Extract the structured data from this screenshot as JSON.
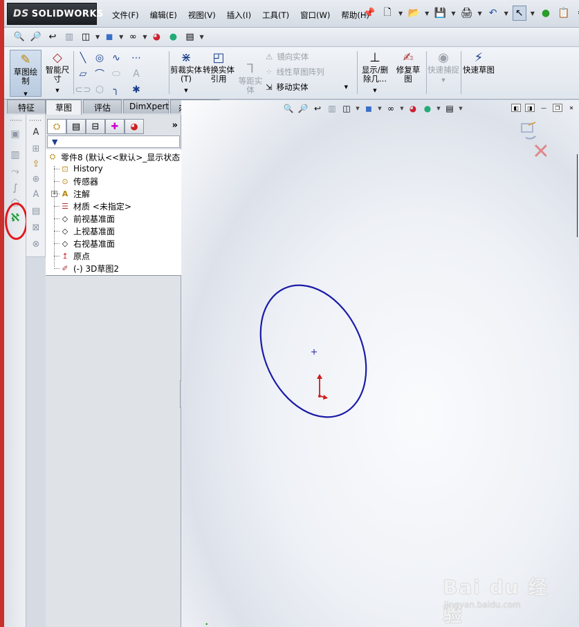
{
  "app": {
    "logo_ds": "DS",
    "logo_text": "SOLIDWORKS"
  },
  "menu": {
    "items": [
      "文件(F)",
      "编辑(E)",
      "视图(V)",
      "插入(I)",
      "工具(T)",
      "窗口(W)",
      "帮助(H)"
    ]
  },
  "command_manager": {
    "sketch": "草图绘制",
    "smart_dim": "智能尺寸",
    "trim": "剪裁实体(T)",
    "convert": "转换实体引用",
    "offset": "等距实体",
    "mirror": "镜向实体",
    "linear_pattern": "线性草图阵列",
    "move": "移动实体",
    "show_delete": "显示/删除几...",
    "repair": "修复草图",
    "quick_snap": "快速捕捉",
    "rapid_sketch": "快速草图"
  },
  "tabs": [
    "特征",
    "草图",
    "评估",
    "DimXpert",
    "办公室产品"
  ],
  "active_tab": "草图",
  "tree": {
    "root": "零件8  (默认<<默认>_显示状态",
    "nodes": [
      {
        "label": "History",
        "icon": "history-icon"
      },
      {
        "label": "传感器",
        "icon": "sensor-icon"
      },
      {
        "label": "注解",
        "icon": "annotation-icon"
      },
      {
        "label": "材质 <未指定>",
        "icon": "material-icon"
      },
      {
        "label": "前视基准面",
        "icon": "plane-icon"
      },
      {
        "label": "上视基准面",
        "icon": "plane-icon"
      },
      {
        "label": "右视基准面",
        "icon": "plane-icon"
      },
      {
        "label": "原点",
        "icon": "origin-icon"
      },
      {
        "label": "(-) 3D草图2",
        "icon": "3d-sketch-icon"
      }
    ],
    "more": "»"
  },
  "viewport": {
    "ellipse_color": "#1a1aa8",
    "origin_color": "#d11a1a"
  },
  "watermark": {
    "main": "Bai du 经验",
    "sub": "jingyan.baidu.com"
  },
  "colors": {
    "accent_red": "#e2191c",
    "highlight_green": "#1f9d3a"
  }
}
